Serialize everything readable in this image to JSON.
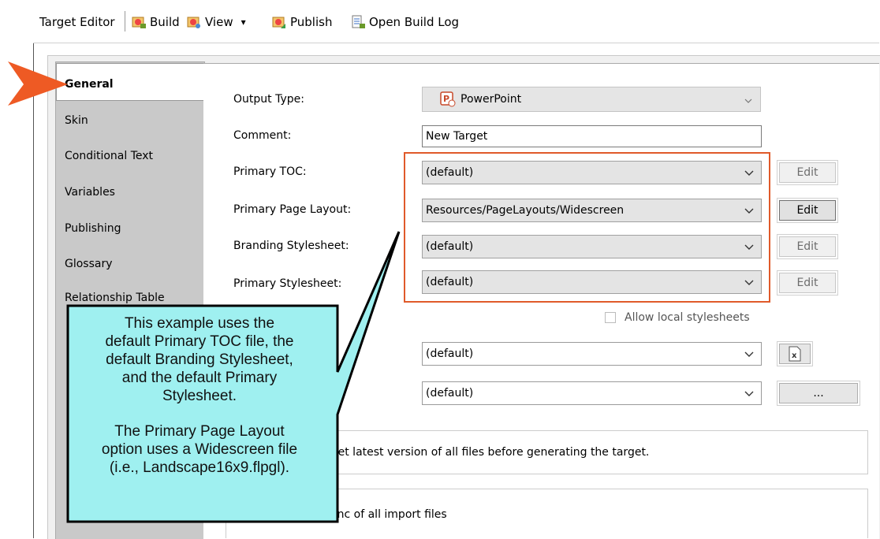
{
  "toolbar": {
    "title": "Target Editor",
    "build": "Build",
    "view": "View",
    "view_arrow": "▾",
    "publish": "Publish",
    "open_build_log": "Open Build Log"
  },
  "sidebar": {
    "items": [
      {
        "label": "General"
      },
      {
        "label": "Skin"
      },
      {
        "label": "Conditional Text"
      },
      {
        "label": "Variables"
      },
      {
        "label": "Publishing"
      },
      {
        "label": "Glossary"
      },
      {
        "label": "Relationship Table"
      }
    ]
  },
  "form": {
    "output_type": {
      "label": "Output Type:",
      "value": "PowerPoint"
    },
    "comment": {
      "label": "Comment:",
      "value": "New Target"
    },
    "primary_toc": {
      "label": "Primary TOC:",
      "value": "(default)",
      "button": "Edit"
    },
    "primary_page_layout": {
      "label": "Primary Page Layout:",
      "value": "Resources/PageLayouts/Widescreen",
      "button": "Edit"
    },
    "branding_stylesheet": {
      "label": "Branding Stylesheet:",
      "value": "(default)",
      "button": "Edit"
    },
    "primary_stylesheet": {
      "label": "Primary Stylesheet:",
      "value": "(default)",
      "button": "Edit"
    },
    "allow_local_stylesheets": {
      "label": "Allow local stylesheets",
      "checked": false
    },
    "select_5": {
      "value": "(default)"
    },
    "select_6": {
      "value": "(default)",
      "button": "..."
    },
    "get_latest_text": "y get latest version of all files before generating the target.",
    "sync_text": "-sync of all import files"
  },
  "callout": {
    "line1": "This example uses the",
    "line2": "default Primary TOC file, the",
    "line3": "default Branding Stylesheet,",
    "line4": "and the default Primary",
    "line5": "Stylesheet.",
    "line6": "The Primary Page Layout",
    "line7": "option uses a Widescreen file",
    "line8": "(i.e., Landscape16x9.flpgl)."
  },
  "colors": {
    "callout_fill": "#9ff0f0",
    "highlight_border": "#e05a2a",
    "arrow": "#ee5a24"
  },
  "icons": {
    "build": "build-icon",
    "view": "view-icon",
    "publish": "publish-icon",
    "log": "build-log-icon",
    "powerpoint": "powerpoint-icon",
    "excel": "excel-icon",
    "pointer_arrow": "pointer-arrow-icon"
  }
}
